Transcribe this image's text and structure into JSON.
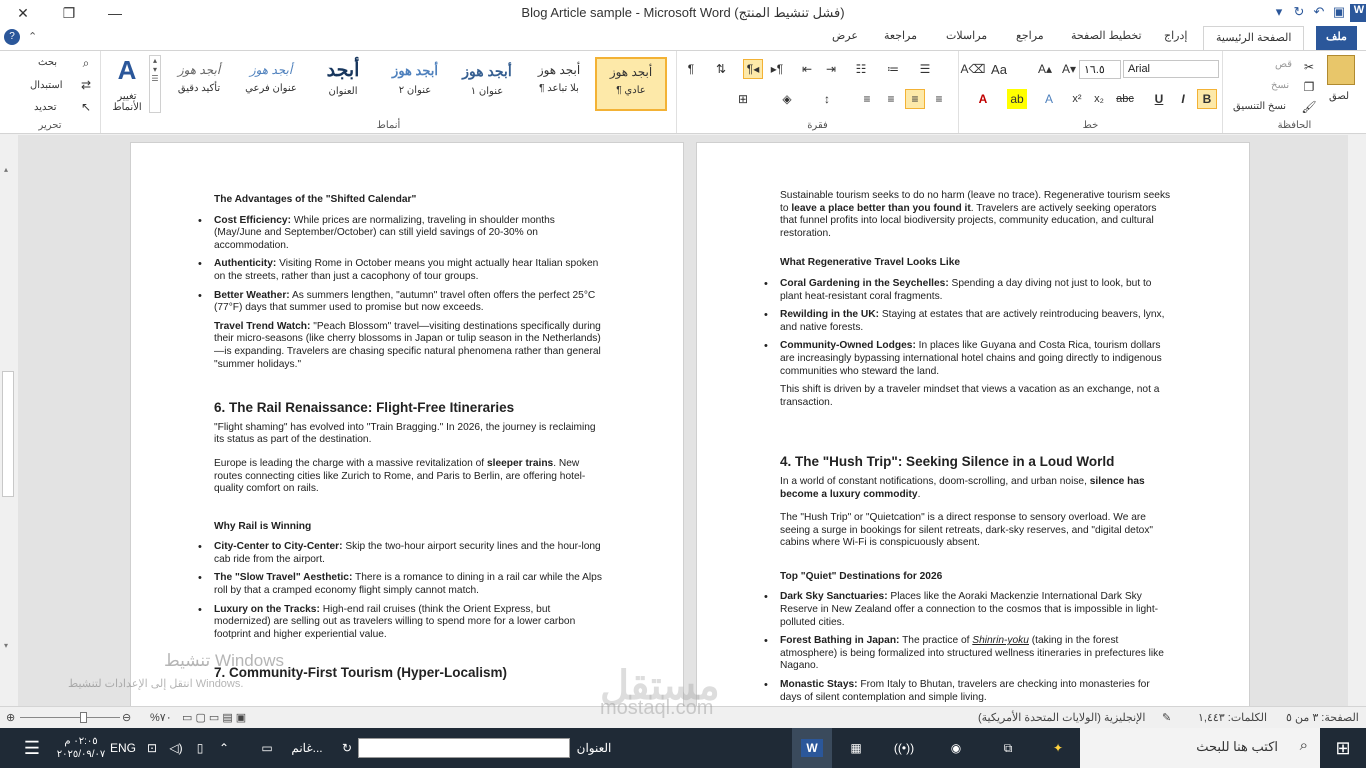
{
  "window": {
    "title": "Blog Article sample  -  Microsoft Word (فشل تنشيط المنتج)",
    "min": "—",
    "max": "❐",
    "close": "✕"
  },
  "tabs": {
    "file": "ملف",
    "home": "الصفحة الرئيسية",
    "insert": "إدراج",
    "layout": "تخطيط الصفحة",
    "references": "مراجع",
    "mailings": "مراسلات",
    "review": "مراجعة",
    "view": "عرض"
  },
  "ribbon": {
    "clipboard": {
      "label": "الحافظة",
      "paste": "لصق",
      "cut": "قص",
      "copy": "نسخ",
      "format_painter": "نسخ التنسيق"
    },
    "font": {
      "label": "خط",
      "font_name": "Arial",
      "font_size": "١٦.٥"
    },
    "paragraph": {
      "label": "فقرة"
    },
    "styles": {
      "label": "أنماط",
      "change_styles": "تغيير الأنماط",
      "items": [
        {
          "sample": "أبجد هوز",
          "name": "¶ عادي"
        },
        {
          "sample": "أبجد هوز",
          "name": "¶ بلا تباعد"
        },
        {
          "sample": "أبجد هوز",
          "name": "عنوان ١"
        },
        {
          "sample": "أبجد هوز",
          "name": "عنوان ٢"
        },
        {
          "sample": "أبجد",
          "name": "العنوان"
        },
        {
          "sample": "أبجد هوز",
          "name": "عنوان فرعي"
        },
        {
          "sample": "أبجد هوز",
          "name": "تأكيد دقيق"
        }
      ]
    },
    "editing": {
      "label": "تحرير",
      "find": "بحث",
      "replace": "استبدال",
      "select": "تحديد"
    }
  },
  "page1": {
    "adv_title": "The Advantages of the \"Shifted Calendar\"",
    "b1_label": "Cost Efficiency:",
    "b1_text": " While prices are normalizing, traveling in shoulder months (May/June and September/October) can still yield savings of 20-30% on accommodation.",
    "b2_label": "Authenticity:",
    "b2_text": " Visiting Rome in October means you might actually hear Italian spoken on the streets, rather than just a cacophony of tour groups.",
    "b3_label": "Better Weather:",
    "b3_text": " As summers lengthen, \"autumn\" travel often offers the perfect 25°C (77°F) days that summer used to promise but now exceeds.",
    "trend_label": "Travel Trend Watch:",
    "trend_text": " \"Peach Blossom\" travel—visiting destinations specifically during their micro-seasons (like cherry blossoms in Japan or tulip season in the Netherlands)—is expanding. Travelers are chasing specific natural phenomena rather than general \"summer holidays.\"",
    "rail_heading": "6. The Rail Renaissance: Flight-Free Itineraries",
    "rail_p1": "\"Flight shaming\" has evolved into \"Train Bragging.\" In 2026, the journey is reclaiming its status as part of the destination.",
    "rail_p2a": "Europe is leading the charge with a massive revitalization of ",
    "rail_p2b": "sleeper trains",
    "rail_p2c": ". New routes connecting cities like Zurich to Rome, and Paris to Berlin, are offering hotel-quality comfort on rails.",
    "why_title": "Why Rail is Winning",
    "r1_label": "City-Center to City-Center:",
    "r1_text": " Skip the two-hour airport security lines and the hour-long cab ride from the airport.",
    "r2_label": "The \"Slow Travel\" Aesthetic:",
    "r2_text": " There is a romance to dining in a rail car while the Alps roll by that a cramped economy flight simply cannot match.",
    "r3_label": "Luxury on the Tracks:",
    "r3_text": " High-end rail cruises (think the Orient Express, but modernized) are selling out as travelers willing to spend more for a lower carbon footprint and higher experiential value.",
    "next_heading": "7. Community-First Tourism (Hyper-Localism)"
  },
  "page2": {
    "p1a": "Sustainable tourism seeks to do no harm (leave no trace). Regenerative tourism seeks to ",
    "p1b": "leave a place better than you found it",
    "p1c": ". Travelers are actively seeking operators that funnel profits into local biodiversity projects, community education, and cultural restoration.",
    "regen_title": "What Regenerative Travel Looks Like",
    "g1_label": "Coral Gardening in the Seychelles:",
    "g1_text": " Spending a day diving not just to look, but to plant heat-resistant coral fragments.",
    "g2_label": "Rewilding in the UK:",
    "g2_text": " Staying at estates that are actively reintroducing beavers, lynx, and native forests.",
    "g3_label": "Community-Owned Lodges:",
    "g3_text": " In places like Guyana and Costa Rica, tourism dollars are increasingly bypassing international hotel chains and going directly to indigenous communities who steward the land.",
    "shift": "This shift is driven by a traveler mindset that views a vacation as an exchange, not a transaction.",
    "hush_heading": "4. The \"Hush Trip\": Seeking Silence in a Loud World",
    "hush_p1a": "In a world of constant notifications, doom-scrolling, and urban noise, ",
    "hush_p1b": "silence has become a luxury commodity",
    "hush_p1c": ".",
    "hush_p2": "The \"Hush Trip\" or \"Quietcation\" is a direct response to sensory overload. We are seeing a surge in bookings for silent retreats, dark-sky reserves, and \"digital detox\" cabins where Wi-Fi is conspicuously absent.",
    "quiet_title": "Top \"Quiet\" Destinations for 2026",
    "q1_label": "Dark Sky Sanctuaries:",
    "q1_text": " Places like the Aoraki Mackenzie International Dark Sky Reserve in New Zealand offer a connection to the cosmos that is impossible in light-polluted cities.",
    "q2_label": "Forest Bathing in Japan:",
    "q2_text1": " The practice of ",
    "q2_italic": "Shinrin-yoku",
    "q2_text2": " (taking in the forest atmosphere) is being formalized into structured wellness itineraries in prefectures like Nagano.",
    "q3_label": "Monastic Stays:",
    "q3_text": " From Italy to Bhutan, travelers are checking into monasteries for days of silent contemplation and simple living."
  },
  "statusbar": {
    "page": "الصفحة: ٣ من ٥",
    "words": "الكلمات: ١,٤٤٣",
    "language": "الإنجليزية (الولايات المتحدة الأمريكية)",
    "zoom": "%٧٠"
  },
  "activation": {
    "line1": "تنشيط Windows",
    "line2": "انتقل إلى الإعدادات لتنشيط Windows."
  },
  "taskbar": {
    "search": "اكتب هنا للبحث",
    "address_label": "العنوان",
    "app": "غانم...",
    "lang": "ENG",
    "time": "٠٢:٠٥ م",
    "date": "٢٠٢٥/٠٩/٠٧"
  },
  "brand_watermark": "مستقل",
  "brand_url": "mostaql.com"
}
